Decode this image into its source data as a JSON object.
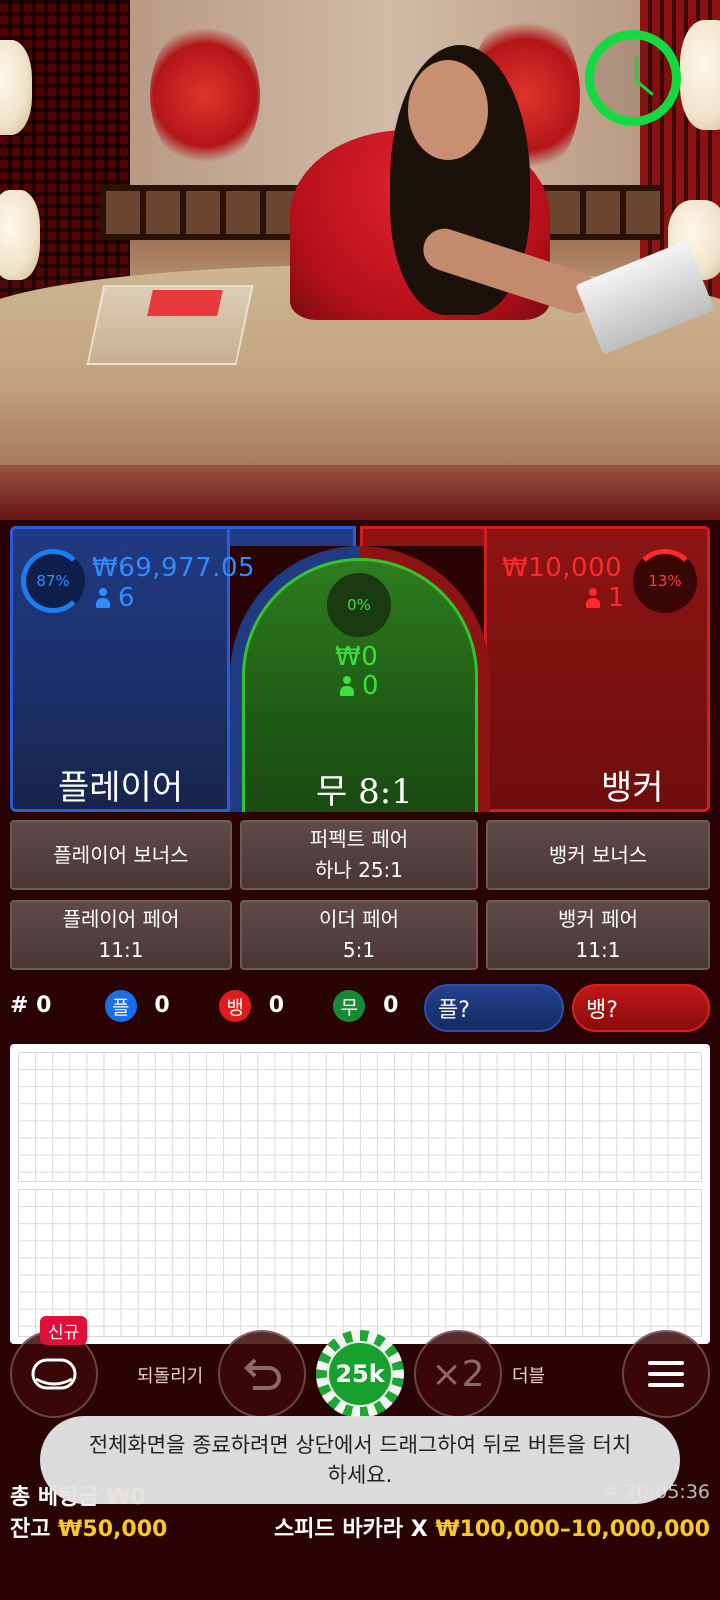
{
  "video": {
    "timer_icon": "clock-icon",
    "timer_color": "#15d940"
  },
  "bets": {
    "player": {
      "label": "플레이어",
      "percent": "87%",
      "amount": "₩69,977.05",
      "players": "6",
      "color": "#2e5ad8"
    },
    "tie": {
      "label": "무 8:1",
      "percent": "0%",
      "amount": "₩0",
      "players": "0",
      "color": "#35c42c"
    },
    "banker": {
      "label": "뱅커",
      "percent": "13%",
      "amount": "₩10,000",
      "players": "1",
      "color": "#d01d1d"
    }
  },
  "side_bets": {
    "player_bonus": "플레이어 보너스",
    "perfect_pair_line1": "퍼펙트 페어",
    "perfect_pair_line2": "하나 25:1",
    "banker_bonus": "뱅커 보너스",
    "player_pair_line1": "플레이어 페어",
    "player_pair_line2": "11:1",
    "either_pair_line1": "이더 페어",
    "either_pair_line2": "5:1",
    "banker_pair_line1": "뱅커 페어",
    "banker_pair_line2": "11:1"
  },
  "stats": {
    "rounds_label": "# 0",
    "player_glyph": "플",
    "player_count": "0",
    "banker_glyph": "뱅",
    "banker_count": "0",
    "tie_glyph": "무",
    "tie_count": "0",
    "predict_player": "플?",
    "predict_banker": "뱅?"
  },
  "controls": {
    "new_badge": "신규",
    "undo_label": "되돌리기",
    "chip_value": "25k",
    "double_symbol": "×2",
    "double_label": "더블"
  },
  "toast": {
    "message": "전체화면을 종료하려면 상단에서 드래그하여 뒤로 버튼을 터치하세요."
  },
  "footer": {
    "total_bet_label": "총 베팅금",
    "total_bet_value": "₩0",
    "round_id": "# 20:05:36",
    "balance_label": "잔고",
    "balance_value": "₩50,000",
    "table_name": "스피드 바카라 X",
    "limits": "₩100,000–10,000,000"
  }
}
